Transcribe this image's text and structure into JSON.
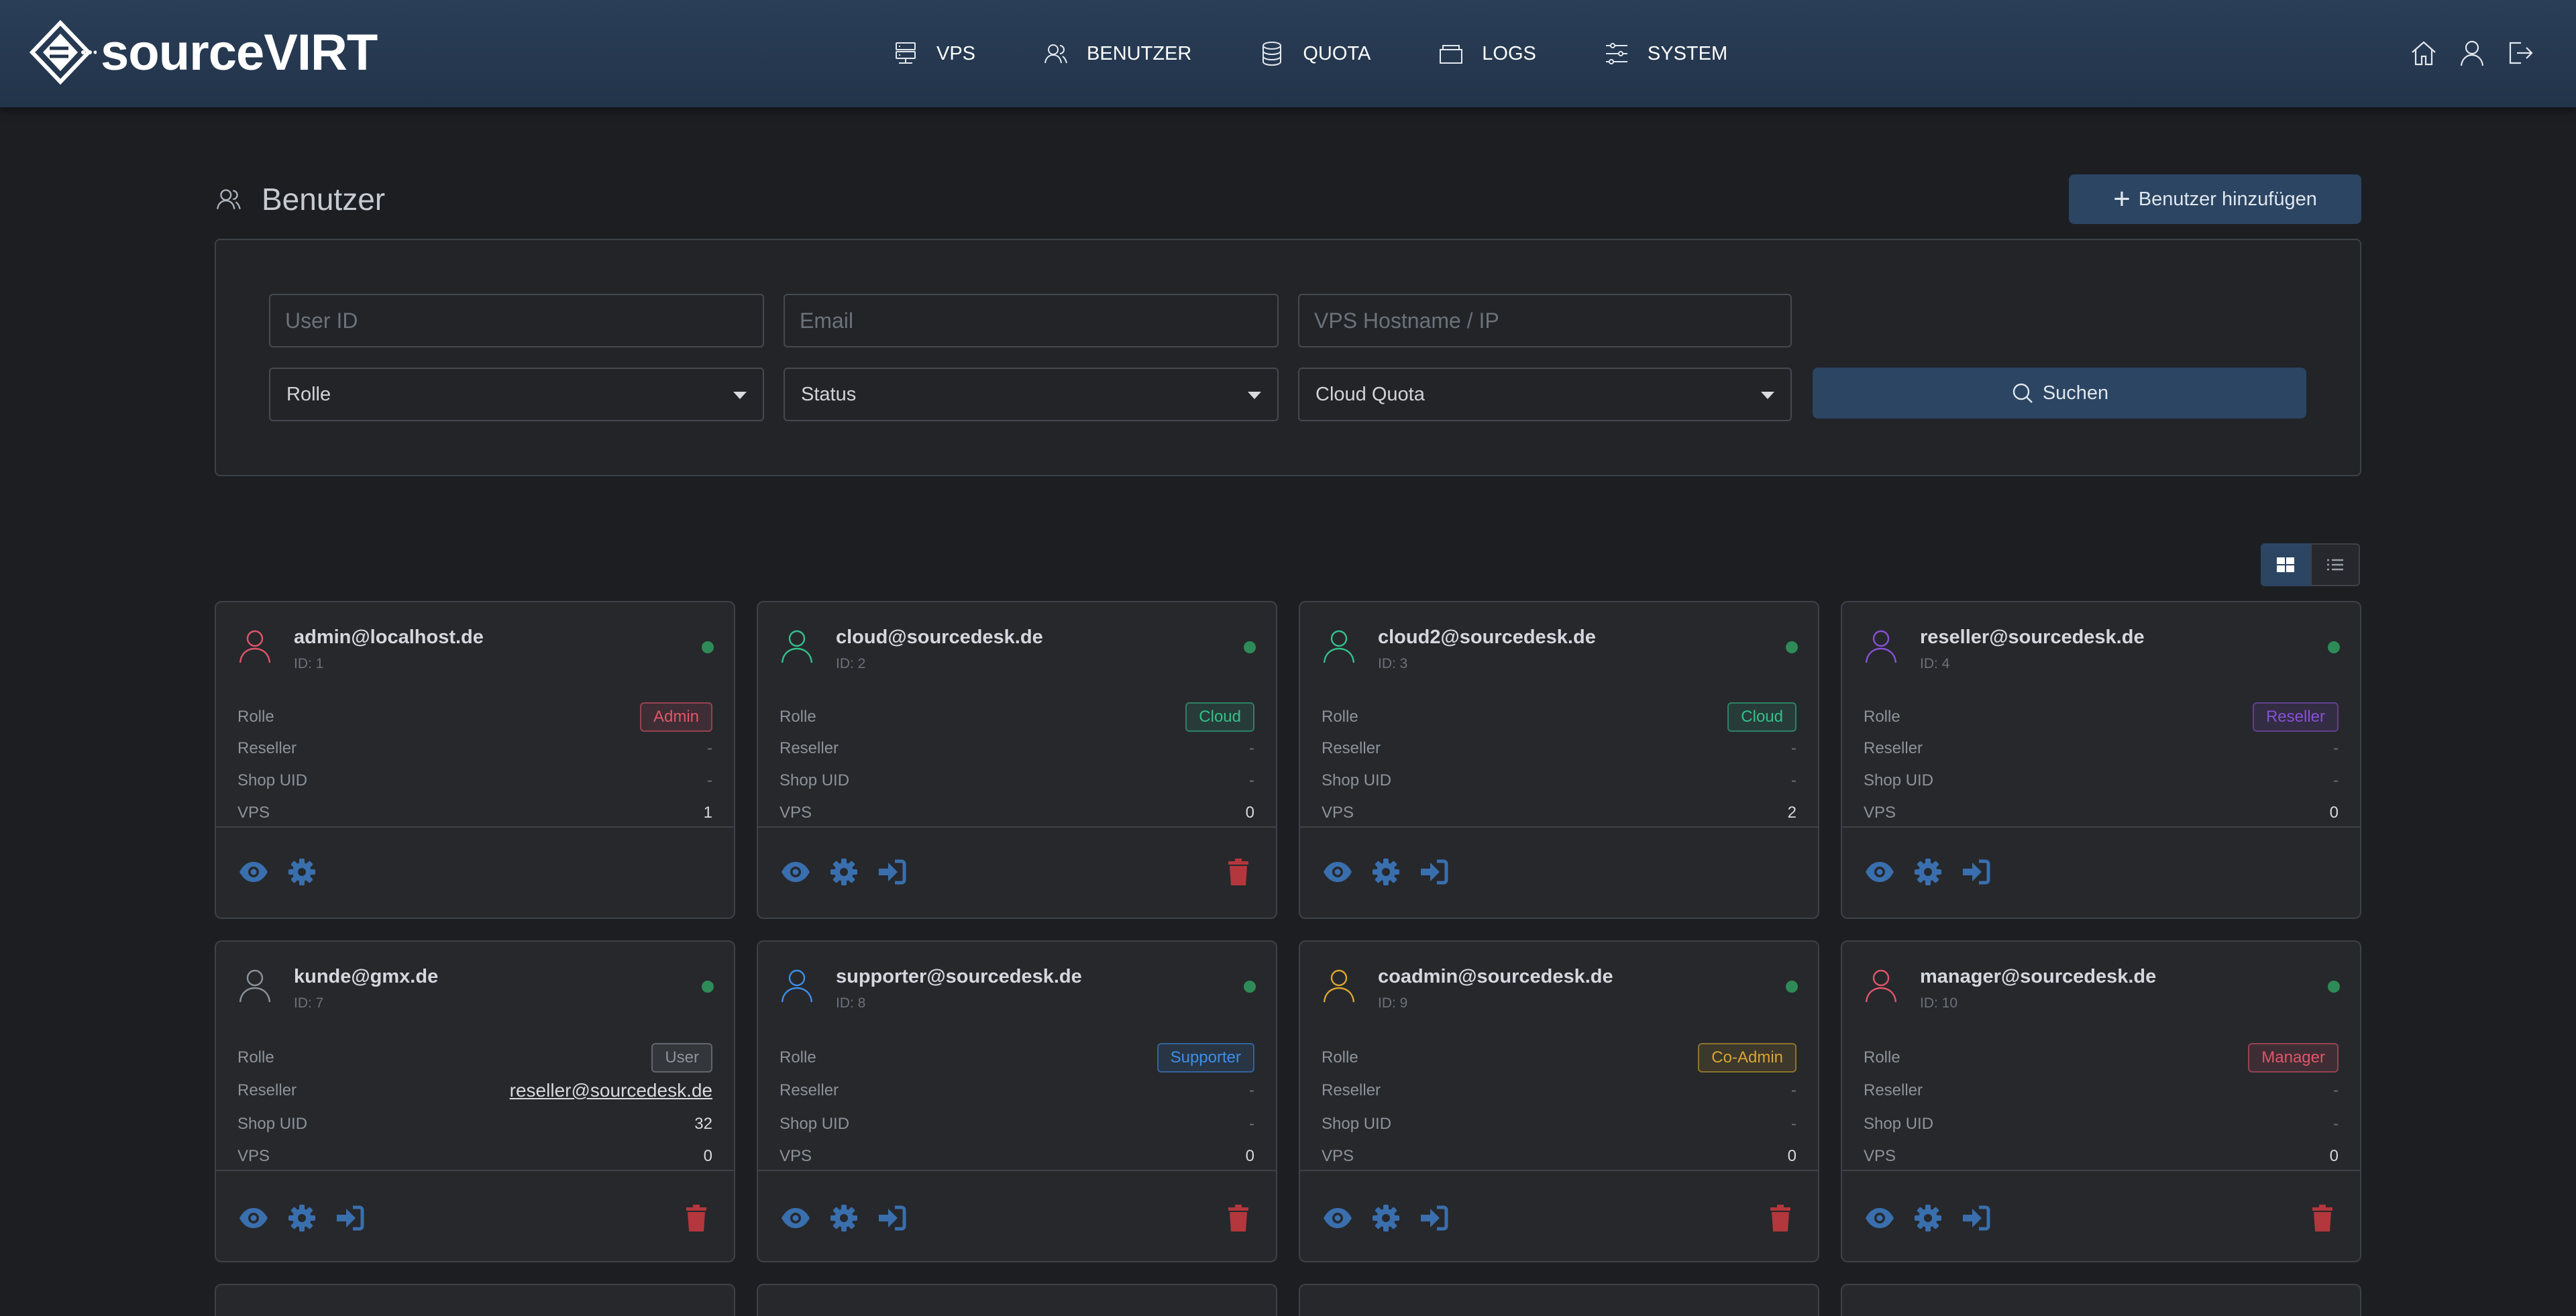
{
  "brand": {
    "name": "sourceVIRT"
  },
  "nav": [
    {
      "label": "VPS",
      "icon": "server-icon"
    },
    {
      "label": "BENUTZER",
      "icon": "users-icon"
    },
    {
      "label": "QUOTA",
      "icon": "database-icon"
    },
    {
      "label": "LOGS",
      "icon": "folder-icon"
    },
    {
      "label": "SYSTEM",
      "icon": "sliders-icon"
    }
  ],
  "nav_right": [
    "home-icon",
    "user-icon",
    "logout-icon"
  ],
  "page": {
    "title": "Benutzer",
    "add_button": "Benutzer hinzufügen"
  },
  "filters": {
    "user_id_placeholder": "User ID",
    "email_placeholder": "Email",
    "vps_placeholder": "VPS Hostname / IP",
    "role_select": "Rolle",
    "status_select": "Status",
    "quota_select": "Cloud Quota",
    "search_button": "Suchen"
  },
  "labels": {
    "role": "Rolle",
    "reseller": "Reseller",
    "shop_uid": "Shop UID",
    "vps": "VPS"
  },
  "colors": {
    "accent": "#2c4563",
    "action_icon": "#3a6fae",
    "delete_icon": "#b3373c",
    "status_online": "#2e8b57"
  },
  "users": [
    {
      "email": "admin@localhost.de",
      "id": "ID: 1",
      "role": "Admin",
      "role_color": "#e0566a",
      "reseller": "-",
      "shop_uid": "-",
      "vps": "1",
      "avatar_color": "#e0566a",
      "can_login_as": false,
      "can_delete": false
    },
    {
      "email": "cloud@sourcedesk.de",
      "id": "ID: 2",
      "role": "Cloud",
      "role_color": "#33c08a",
      "reseller": "-",
      "shop_uid": "-",
      "vps": "0",
      "avatar_color": "#33c08a",
      "can_login_as": true,
      "can_delete": true
    },
    {
      "email": "cloud2@sourcedesk.de",
      "id": "ID: 3",
      "role": "Cloud",
      "role_color": "#33c08a",
      "reseller": "-",
      "shop_uid": "-",
      "vps": "2",
      "avatar_color": "#33c08a",
      "can_login_as": true,
      "can_delete": false
    },
    {
      "email": "reseller@sourcedesk.de",
      "id": "ID: 4",
      "role": "Reseller",
      "role_color": "#8a4fd6",
      "reseller": "-",
      "shop_uid": "-",
      "vps": "0",
      "avatar_color": "#8a4fd6",
      "can_login_as": true,
      "can_delete": false
    },
    {
      "email": "kunde@gmx.de",
      "id": "ID: 7",
      "role": "User",
      "role_color": "#8d939a",
      "reseller": "reseller@sourcedesk.de",
      "shop_uid": "32",
      "vps": "0",
      "avatar_color": "#8d939a",
      "can_login_as": true,
      "can_delete": true
    },
    {
      "email": "supporter@sourcedesk.de",
      "id": "ID: 8",
      "role": "Supporter",
      "role_color": "#3d8fe6",
      "reseller": "-",
      "shop_uid": "-",
      "vps": "0",
      "avatar_color": "#3d8fe6",
      "can_login_as": true,
      "can_delete": true
    },
    {
      "email": "coadmin@sourcedesk.de",
      "id": "ID: 9",
      "role": "Co-Admin",
      "role_color": "#d9a530",
      "reseller": "-",
      "shop_uid": "-",
      "vps": "0",
      "avatar_color": "#d9a530",
      "can_login_as": true,
      "can_delete": true
    },
    {
      "email": "manager@sourcedesk.de",
      "id": "ID: 10",
      "role": "Manager",
      "role_color": "#e0566a",
      "reseller": "-",
      "shop_uid": "-",
      "vps": "0",
      "avatar_color": "#e0566a",
      "can_login_as": true,
      "can_delete": true
    }
  ]
}
